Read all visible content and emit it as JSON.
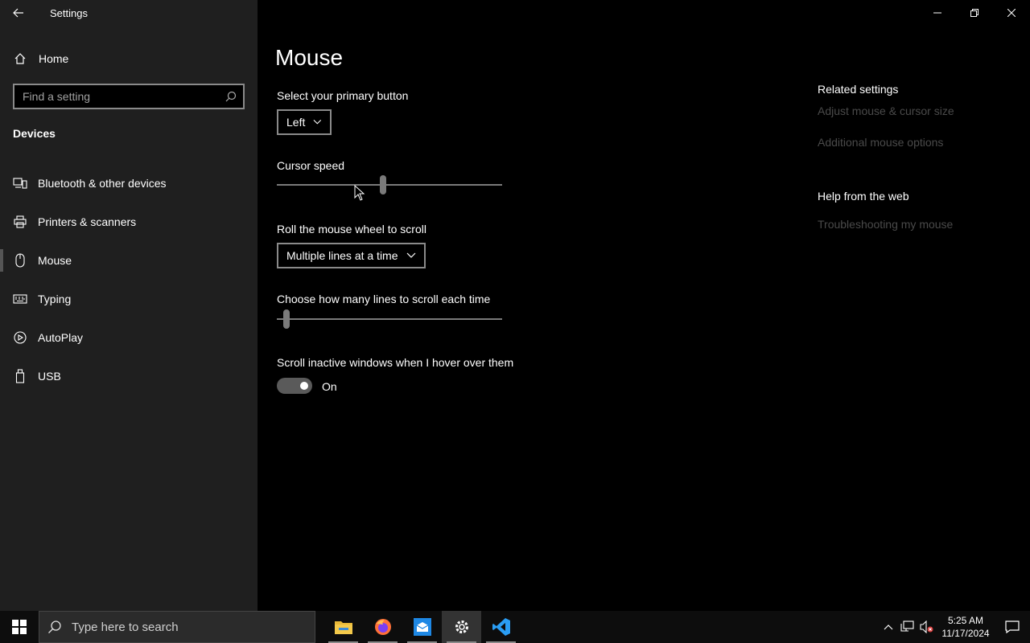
{
  "window": {
    "title": "Settings"
  },
  "sidebar": {
    "home_label": "Home",
    "search_placeholder": "Find a setting",
    "section": "Devices",
    "items": [
      {
        "label": "Bluetooth & other devices",
        "icon": "bluetooth-devices-icon"
      },
      {
        "label": "Printers & scanners",
        "icon": "printer-icon"
      },
      {
        "label": "Mouse",
        "icon": "mouse-icon",
        "selected": true
      },
      {
        "label": "Typing",
        "icon": "keyboard-icon"
      },
      {
        "label": "AutoPlay",
        "icon": "autoplay-icon"
      },
      {
        "label": "USB",
        "icon": "usb-icon"
      }
    ]
  },
  "main": {
    "title": "Mouse",
    "primary_button": {
      "label": "Select your primary button",
      "value": "Left"
    },
    "cursor_speed": {
      "label": "Cursor speed",
      "value_fraction": 0.47
    },
    "scroll_mode": {
      "label": "Roll the mouse wheel to scroll",
      "value": "Multiple lines at a time"
    },
    "scroll_lines": {
      "label": "Choose how many lines to scroll each time",
      "value_fraction": 0.03
    },
    "inactive_scroll": {
      "label": "Scroll inactive windows when I hover over them",
      "state": "On"
    },
    "related": {
      "heading": "Related settings",
      "links": [
        "Adjust mouse & cursor size",
        "Additional mouse options"
      ]
    },
    "help": {
      "heading": "Help from the web",
      "links": [
        "Troubleshooting my mouse"
      ]
    }
  },
  "taskbar": {
    "search_placeholder": "Type here to search",
    "time": "5:25 AM",
    "date": "11/17/2024",
    "apps": [
      "file-explorer-icon",
      "firefox-icon",
      "mail-app-icon",
      "settings-gear-icon",
      "vscode-icon"
    ]
  },
  "colors": {
    "sidebar_bg": "#1f1f1f",
    "main_bg": "#000000",
    "accent_gray": "#7a7a7a",
    "disabled_link": "#4a4a4a"
  }
}
